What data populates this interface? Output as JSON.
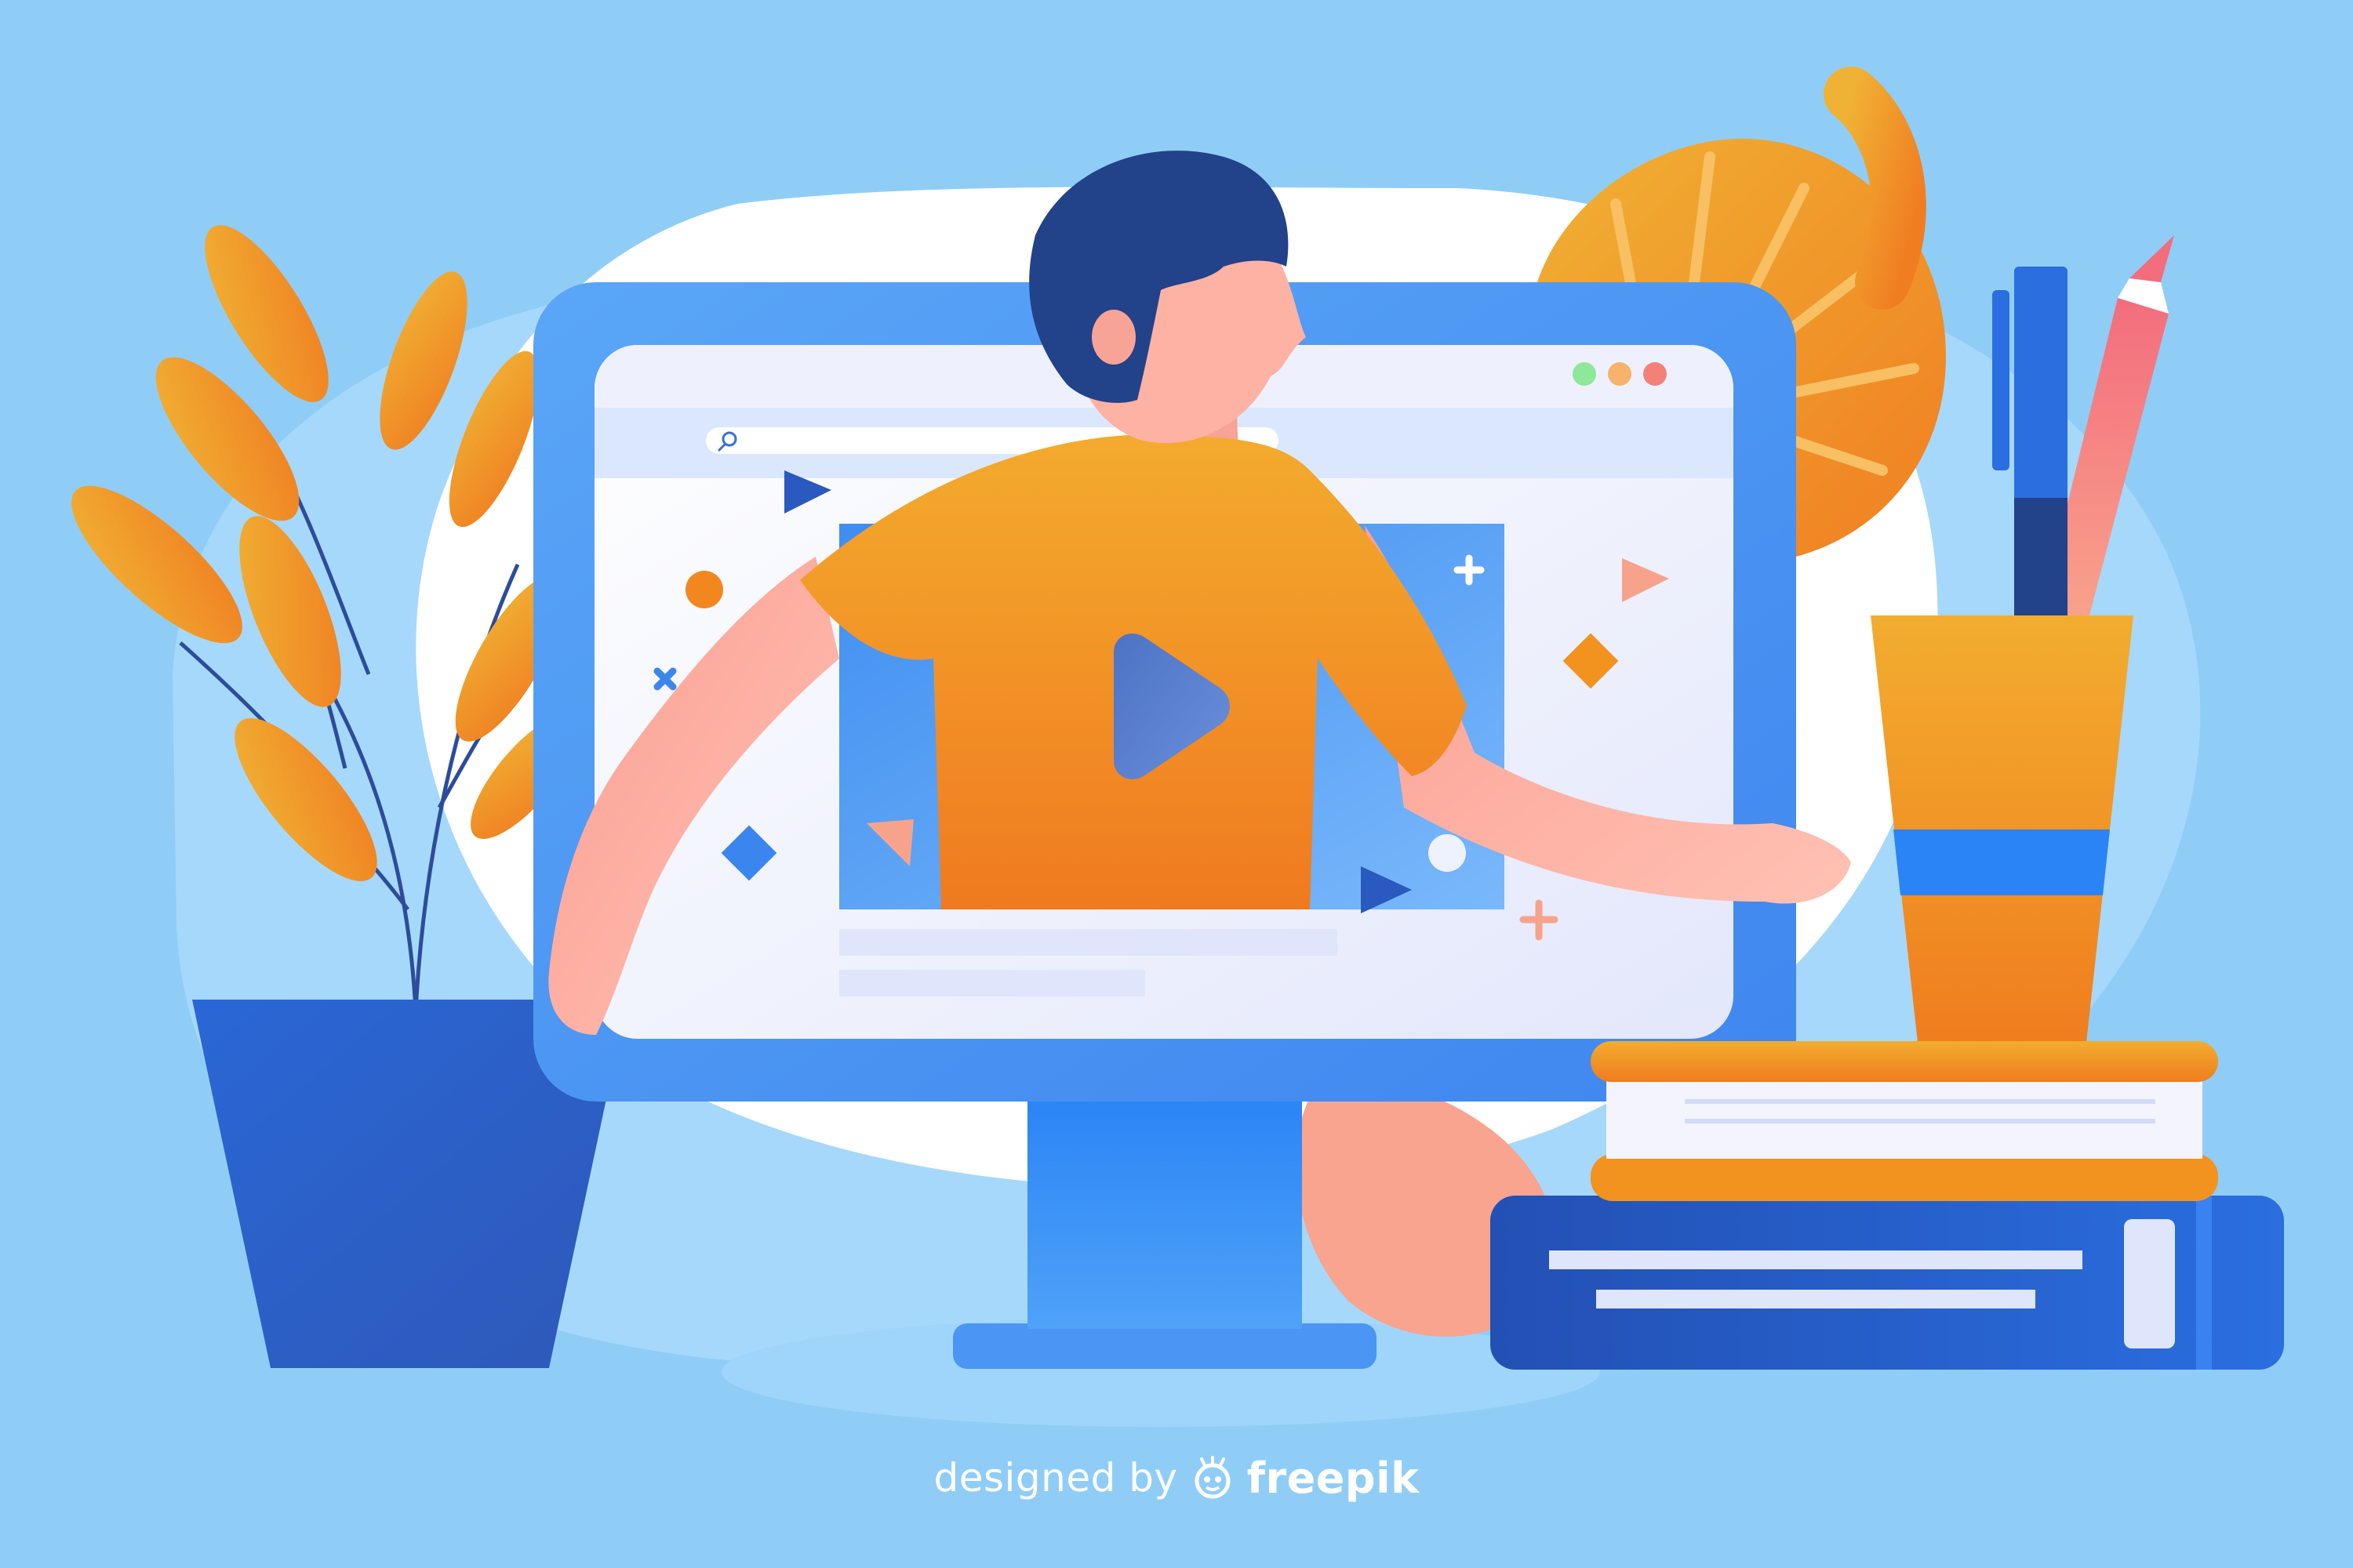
{
  "scene": {
    "description_tag": "online-video-learning-illustration",
    "colors": {
      "background": "#8fcdf7",
      "monitor_blue": "#4f9ef6",
      "orange": "#f39a2a",
      "navy": "#22428a",
      "skin": "#fdb2a4",
      "white": "#ffffff"
    },
    "browser": {
      "window_buttons": [
        "green-dot",
        "orange-dot",
        "red-dot"
      ]
    },
    "video_player": {
      "icon": "play-button-icon"
    }
  },
  "credit": {
    "prefix": "designed by",
    "brand": "freepik",
    "logo_icon": "freepik-logo-icon"
  }
}
